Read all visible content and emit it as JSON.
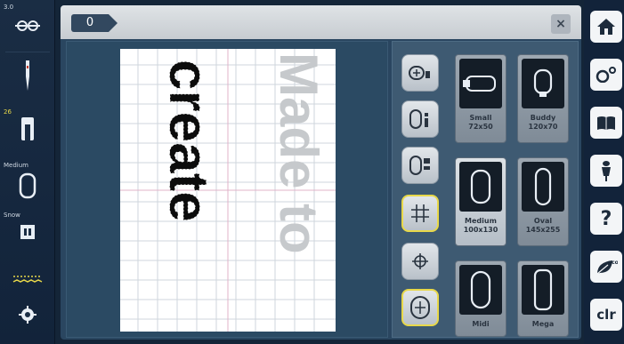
{
  "left_bar": {
    "top_label": "3.0",
    "stitch_label": "26",
    "hoop_label": "Medium",
    "snow_label": "Snow"
  },
  "header": {
    "tab_label": "0",
    "close_label": "×"
  },
  "canvas": {
    "text_made": "Made to",
    "text_create": "create"
  },
  "hoops": [
    {
      "name": "Small",
      "size": "72x50"
    },
    {
      "name": "Buddy",
      "size": "120x70"
    },
    {
      "name": "Medium",
      "size": "100x130"
    },
    {
      "name": "Oval",
      "size": "145x255"
    },
    {
      "name": "Midi",
      "size": ""
    },
    {
      "name": "Mega",
      "size": ""
    }
  ],
  "right_bar": {
    "clr_label": "clr",
    "help_label": "?",
    "eco_label": "eco"
  },
  "colors": {
    "accent_yellow": "#e8d84a",
    "panel_blue": "#2a4660",
    "hoop_white": "#ffffff"
  }
}
